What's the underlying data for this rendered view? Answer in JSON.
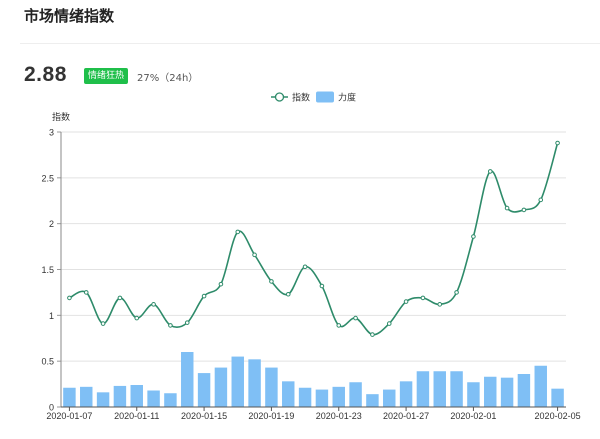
{
  "header": {
    "title": "市场情绪指数"
  },
  "summary": {
    "value": "2.88",
    "badge": "情绪狂热",
    "change": "27%（24h）",
    "badge_color": "#1fbf4a"
  },
  "chart_data": {
    "type": "bar+line",
    "ylabel": "指数",
    "ylim": [
      0,
      3
    ],
    "yticks": [
      "0",
      "0.5",
      "1",
      "1.5",
      "2",
      "2.5",
      "3"
    ],
    "x_tick_labels": [
      "2020-01-07",
      "2020-01-11",
      "2020-01-15",
      "2020-01-19",
      "2020-01-23",
      "2020-01-27",
      "2020-02-01",
      "2020-02-05"
    ],
    "legend_position": "top-center",
    "grid": true,
    "series": [
      {
        "name": "指数",
        "type": "line",
        "color": "#2e8b6a",
        "values": [
          1.19,
          1.25,
          0.91,
          1.19,
          0.97,
          1.12,
          0.89,
          0.92,
          1.21,
          1.34,
          1.91,
          1.66,
          1.37,
          1.23,
          1.53,
          1.32,
          0.89,
          0.97,
          0.79,
          0.91,
          1.15,
          1.19,
          1.12,
          1.25,
          1.86,
          2.57,
          2.17,
          2.15,
          2.26,
          2.88
        ]
      },
      {
        "name": "力度",
        "type": "bar",
        "color": "#7fbff5",
        "values": [
          0.21,
          0.22,
          0.16,
          0.23,
          0.24,
          0.18,
          0.15,
          0.6,
          0.37,
          0.43,
          0.55,
          0.52,
          0.43,
          0.28,
          0.21,
          0.19,
          0.22,
          0.27,
          0.14,
          0.19,
          0.28,
          0.39,
          0.39,
          0.39,
          0.27,
          0.33,
          0.32,
          0.36,
          0.45,
          0.2
        ]
      }
    ]
  }
}
